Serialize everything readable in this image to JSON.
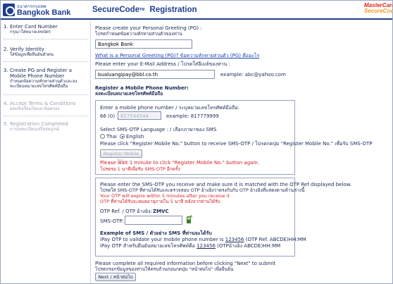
{
  "header": {
    "bank_thai": "ธนาคารกรุงเทพ",
    "bank_name": "Bangkok Bank",
    "securecode": "SecureCode",
    "tm": "TM",
    "title": "Registration",
    "mc_line1": "MasterCard",
    "mc_line2": "SecureCode"
  },
  "sidebar": {
    "steps": [
      {
        "num": "1.",
        "en": "Enter Card Number",
        "th": "กรุณาใส่หมายเลขบัตร",
        "active": true
      },
      {
        "num": "2.",
        "en": "Verify Identity",
        "th": "ใส่ข้อมูลเพื่อยืนยันตัวตน",
        "active": true
      },
      {
        "num": "3.",
        "en": "Create PG and Register a Mobile Phone Number",
        "th": "กำหนดข้อความทักทายส่วนตัวและลงทะเบียนหมายเลขโทรศัพท์มือถือ",
        "active": true
      },
      {
        "num": "4.",
        "en": "Accept Terms & Conditions",
        "th": "ยอมรับเงื่อนไขและข้อตกลง",
        "active": false
      },
      {
        "num": "5.",
        "en": "Registration Completed",
        "th": "การลงทะเบียนเสร็จสมบูรณ์",
        "active": false
      }
    ]
  },
  "form": {
    "pg_prompt": "Please create your Personal Greeting (PG) :",
    "pg_prompt_th": "โปรดกำหนดข้อความทักทายส่วนตัวของท่าน",
    "pg_value": "Bangkok Bank",
    "pg_link": "What is a Personal Greeting (PG)? ข้อความทักทายส่วนตัว (PG) คืออะไร",
    "email_prompt": "Please enter your E-Mail Address / โปรดใส่อีเมล์ของท่าน :",
    "email_value": "bualuangipay@bbl.co.th",
    "email_example": "example: abc@yahoo.com",
    "mobile_heading": "Register a Mobile Phone Number:",
    "mobile_heading_th": "ลงทะเบียนหมายเลขโทรศัพท์มือถือ",
    "mobile_prompt": "Enter a mobile phone number / ระบุหมายเลขโทรศัพท์มือถือ:",
    "country_prefix": "66 (0)",
    "mobile_placeholder": "817544544",
    "mobile_example": "example: 817779999",
    "lang_prompt": "Select SMS-OTP Language : / เลือกภาษาของ SMS",
    "lang_thai": "Thai",
    "lang_english": "English",
    "register_instruction": "Please click \"Register Mobile No.\" button to receive SMS-OTP / โปรดกดปุ่ม \"Register Mobile No.\" เพื่อรับ SMS-OTP",
    "register_button": "Register Mobile No.",
    "wait_msg": "Please wait 1 minute to click \"Register Mobile No.\" button again.",
    "wait_msg_th": "โปรดรอ 1 นาทีเพื่อรับ SMS-OTP อีกครั้ง",
    "otp_instruction": "Please enter the SMS-OTP you receive and make sure it is matched with the OTP Ref displayed below.",
    "otp_instruction_th": "โปรดใส่ SMS-OTP ที่ท่านได้รับและตรวจสอบ OTP อ้างอิงว่าตรงกับกับ OTP อ้างอิงที่แสดงตามด้านล่างนี้",
    "otp_expire": "Your OTP will expire within 5 minutes after you receive it",
    "otp_expire_th": "OTP ที่ท่านได้รับจะหมดอายุภายใน 5 นาที หลังจากท่านได้รับ",
    "otp_ref_label": "OTP Ref. / OTP อ้างอิง:",
    "otp_ref_value": "ZMVC",
    "sms_otp_label": "SMS-OTP:",
    "sms_example_heading": "Example of SMS / ตัวอย่าง SMS ที่ท่านจะได้รับ",
    "sms_example_en_pre": "iPay OTP to validate your mobile phone number is ",
    "sms_example_code": "123456",
    "sms_example_en_post": " (OTP Ref. ABCDE)HH:MM",
    "sms_example_th_pre": "iPay OTP สำหรับยืนยันหมายเลขโทรศัพท์คือ ",
    "sms_example_th_post": " (OTPอ้างอิง ABCDE)HH:MM",
    "footer_note": "Please complete all required information before clicking \"Next\" to submit",
    "footer_note_th": "โปรดกรอกข้อมูลของท่านให้ครบถ้วนก่อนกดปุ่ม \"หน้าต่อไป\" เพื่อยืนยัน",
    "next_button": "Next / หน้าต่อไป"
  }
}
